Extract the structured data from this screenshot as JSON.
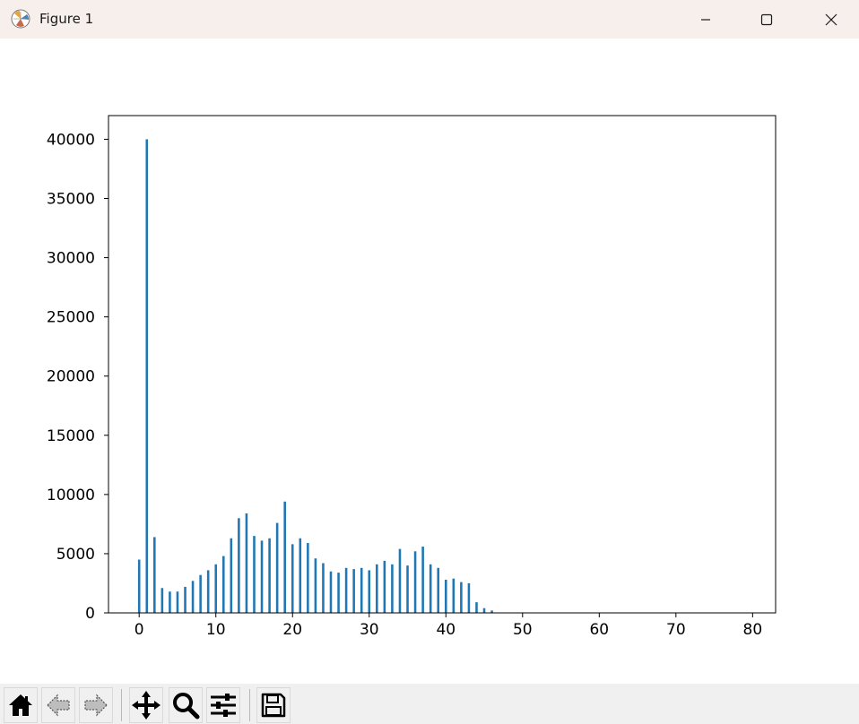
{
  "window": {
    "title": "Figure 1",
    "controls": [
      "minimize-icon",
      "maximize-icon",
      "close-icon"
    ]
  },
  "toolbar": {
    "buttons": [
      {
        "name": "home-icon"
      },
      {
        "name": "back-arrow-icon"
      },
      {
        "name": "forward-arrow-icon"
      },
      {
        "name": "pan-move-icon"
      },
      {
        "name": "zoom-magnifier-icon"
      },
      {
        "name": "configure-subplots-icon"
      },
      {
        "name": "save-floppy-icon"
      }
    ]
  },
  "colors": {
    "bar": "#1f77b4",
    "titlebar": "#f7efec",
    "toolbar": "#f0f0f0"
  },
  "chart_data": {
    "type": "bar",
    "title": "",
    "xlabel": "",
    "ylabel": "",
    "xlim": [
      -4,
      83
    ],
    "ylim": [
      0,
      42000
    ],
    "grid": false,
    "bar_width": 0.3,
    "x": [
      0,
      1,
      2,
      3,
      4,
      5,
      6,
      7,
      8,
      9,
      10,
      11,
      12,
      13,
      14,
      15,
      16,
      17,
      18,
      19,
      20,
      21,
      22,
      23,
      24,
      25,
      26,
      27,
      28,
      29,
      30,
      31,
      32,
      33,
      34,
      35,
      36,
      37,
      38,
      39,
      40,
      41,
      42,
      43,
      44,
      45,
      46
    ],
    "values": [
      4500,
      40000,
      6400,
      2100,
      1800,
      1800,
      2200,
      2700,
      3200,
      3600,
      4100,
      4800,
      6300,
      8000,
      8400,
      6500,
      6100,
      6300,
      7600,
      9400,
      5800,
      6300,
      5900,
      4600,
      4200,
      3500,
      3400,
      3800,
      3700,
      3800,
      3600,
      4100,
      4400,
      4100,
      5400,
      4000,
      5200,
      5600,
      4100,
      3800,
      2800,
      2900,
      2600,
      2500,
      900,
      400,
      200
    ],
    "xticks": [
      "0",
      "10",
      "20",
      "30",
      "40",
      "50",
      "60",
      "70",
      "80"
    ],
    "yticks": [
      "0",
      "5000",
      "10000",
      "15000",
      "20000",
      "25000",
      "30000",
      "35000",
      "40000"
    ]
  }
}
